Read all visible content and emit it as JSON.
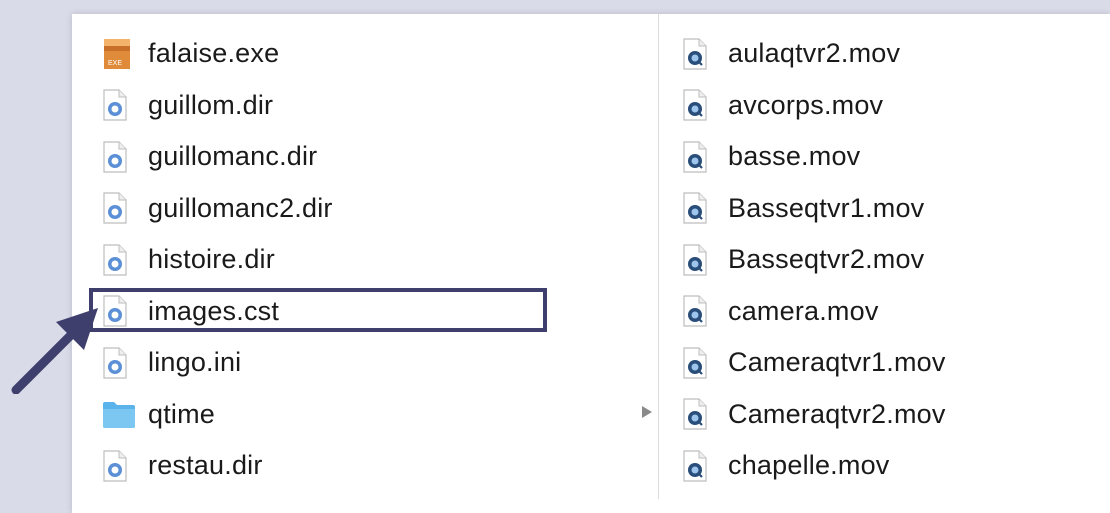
{
  "colors": {
    "background": "#d9dbe9",
    "panel": "#ffffff",
    "highlight_border": "#3e3f6d",
    "arrow": "#3e3f6d",
    "folder": "#5ab3ea",
    "exe": "#e08b3a"
  },
  "left_column": {
    "items": [
      {
        "name": "falaise.exe",
        "icon": "exe-icon"
      },
      {
        "name": "guillom.dir",
        "icon": "director-file-icon"
      },
      {
        "name": "guillomanc.dir",
        "icon": "director-file-icon"
      },
      {
        "name": "guillomanc2.dir",
        "icon": "director-file-icon"
      },
      {
        "name": "histoire.dir",
        "icon": "director-file-icon"
      },
      {
        "name": "images.cst",
        "icon": "director-file-icon",
        "highlighted": true
      },
      {
        "name": "lingo.ini",
        "icon": "director-file-icon"
      },
      {
        "name": "qtime",
        "icon": "folder-icon",
        "selected_folder": true
      },
      {
        "name": "restau.dir",
        "icon": "director-file-icon"
      }
    ]
  },
  "right_column": {
    "items": [
      {
        "name": "aulaqtvr2.mov",
        "icon": "quicktime-file-icon"
      },
      {
        "name": "avcorps.mov",
        "icon": "quicktime-file-icon"
      },
      {
        "name": "basse.mov",
        "icon": "quicktime-file-icon"
      },
      {
        "name": "Basseqtvr1.mov",
        "icon": "quicktime-file-icon"
      },
      {
        "name": "Basseqtvr2.mov",
        "icon": "quicktime-file-icon"
      },
      {
        "name": "camera.mov",
        "icon": "quicktime-file-icon"
      },
      {
        "name": "Cameraqtvr1.mov",
        "icon": "quicktime-file-icon"
      },
      {
        "name": "Cameraqtvr2.mov",
        "icon": "quicktime-file-icon"
      },
      {
        "name": "chapelle.mov",
        "icon": "quicktime-file-icon"
      }
    ]
  }
}
